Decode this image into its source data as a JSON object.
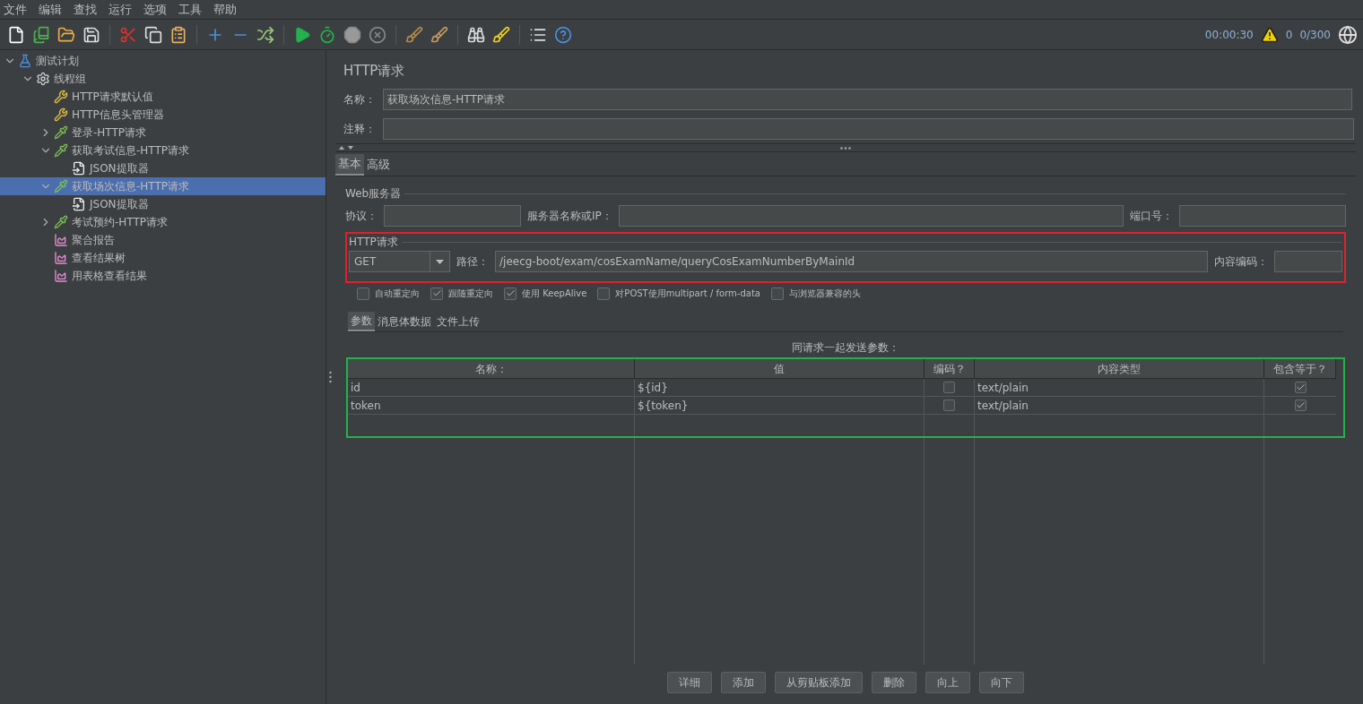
{
  "menu": [
    "文件",
    "编辑",
    "查找",
    "运行",
    "选项",
    "工具",
    "帮助"
  ],
  "status": {
    "elapsed": "00:00:30",
    "warnings": "0",
    "threads": "0/300"
  },
  "tree": [
    {
      "label": "测试计划",
      "kind": "plan",
      "expanded": true,
      "selected": false,
      "children": [
        {
          "label": "线程组",
          "kind": "threads",
          "expanded": true,
          "selected": false,
          "children": [
            {
              "label": "HTTP请求默认值",
              "kind": "config",
              "selected": false
            },
            {
              "label": "HTTP信息头管理器",
              "kind": "config",
              "selected": false
            },
            {
              "label": "登录-HTTP请求",
              "kind": "sampler",
              "expanded": false,
              "selected": false
            },
            {
              "label": "获取考试信息-HTTP请求",
              "kind": "sampler",
              "expanded": true,
              "selected": false,
              "children": [
                {
                  "label": "JSON提取器",
                  "kind": "extractor",
                  "selected": false
                }
              ]
            },
            {
              "label": "获取场次信息-HTTP请求",
              "kind": "sampler",
              "expanded": true,
              "selected": true,
              "children": [
                {
                  "label": "JSON提取器",
                  "kind": "extractor",
                  "selected": false
                }
              ]
            },
            {
              "label": "考试预约-HTTP请求",
              "kind": "sampler",
              "expanded": false,
              "selected": false
            },
            {
              "label": "聚合报告",
              "kind": "listener",
              "selected": false
            },
            {
              "label": "查看结果树",
              "kind": "listener",
              "selected": false
            },
            {
              "label": "用表格查看结果",
              "kind": "listener",
              "selected": false
            }
          ]
        }
      ]
    }
  ],
  "panel": {
    "title": "HTTP请求",
    "name_label": "名称：",
    "name_value": "获取场次信息-HTTP请求",
    "comment_label": "注释：",
    "tabs": [
      {
        "label": "基本",
        "selected": true
      },
      {
        "label": "高级",
        "selected": false
      }
    ],
    "web_server": {
      "legend": "Web服务器",
      "protocol_label": "协议：",
      "server_label": "服务器名称或IP：",
      "port_label": "端口号："
    },
    "http_request": {
      "legend": "HTTP请求",
      "method": "GET",
      "path_label": "路径：",
      "path": "/jeecg-boot/exam/cosExamName/queryCosExamNumberByMainId",
      "encoding_label": "内容编码："
    },
    "options": [
      {
        "label": "自动重定向",
        "checked": false
      },
      {
        "label": "跟随重定向",
        "checked": true
      },
      {
        "label": "使用 KeepAlive",
        "checked": true
      },
      {
        "label": "对POST使用multipart / form-data",
        "checked": false
      },
      {
        "label": "与浏览器兼容的头",
        "checked": false
      }
    ],
    "sub_tabs": [
      {
        "label": "参数",
        "selected": true
      },
      {
        "label": "消息体数据",
        "selected": false
      },
      {
        "label": "文件上传",
        "selected": false
      }
    ],
    "params_caption": "同请求一起发送参数：",
    "columns": [
      "名称：",
      "值",
      "编码？",
      "内容类型",
      "包含等于？"
    ],
    "rows": [
      {
        "name": "id",
        "value": "${id}",
        "encode": false,
        "content_type": "text/plain",
        "include_equals": true
      },
      {
        "name": "token",
        "value": "${token}",
        "encode": false,
        "content_type": "text/plain",
        "include_equals": true
      }
    ],
    "buttons": [
      "详细",
      "添加",
      "从剪贴板添加",
      "删除",
      "向上",
      "向下"
    ]
  }
}
